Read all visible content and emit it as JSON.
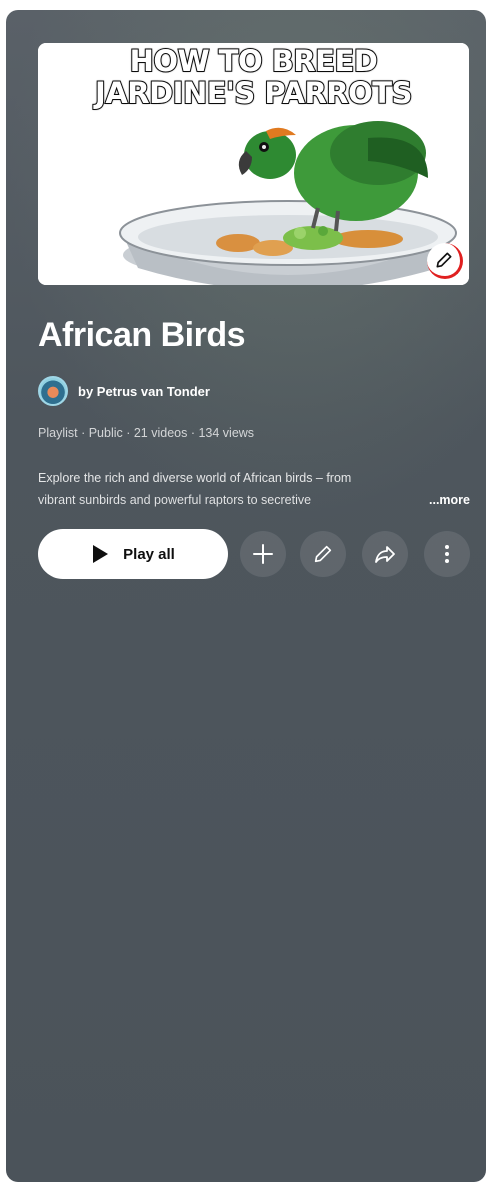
{
  "thumbnail": {
    "title_line1": "HOW TO BREED",
    "title_line2": "JARDINE'S PARROTS",
    "edit_icon": "pencil-icon"
  },
  "playlist": {
    "title": "African Birds",
    "owner": "by Petrus van Tonder",
    "meta": "Playlist · Public · 21 videos · 134 views",
    "description_line1": "Explore the rich and diverse world of African birds – from",
    "description_line2": "vibrant sunbirds and powerful raptors to secretive",
    "more_label": "...more"
  },
  "actions": {
    "play_all_label": "Play all",
    "add_icon": "plus-icon",
    "edit_icon": "pencil-icon",
    "share_icon": "share-icon",
    "more_icon": "more-vert-icon"
  },
  "colors": {
    "panel": "#4e565d",
    "button_bg": "#ffffff",
    "accent_red": "#e02020"
  }
}
